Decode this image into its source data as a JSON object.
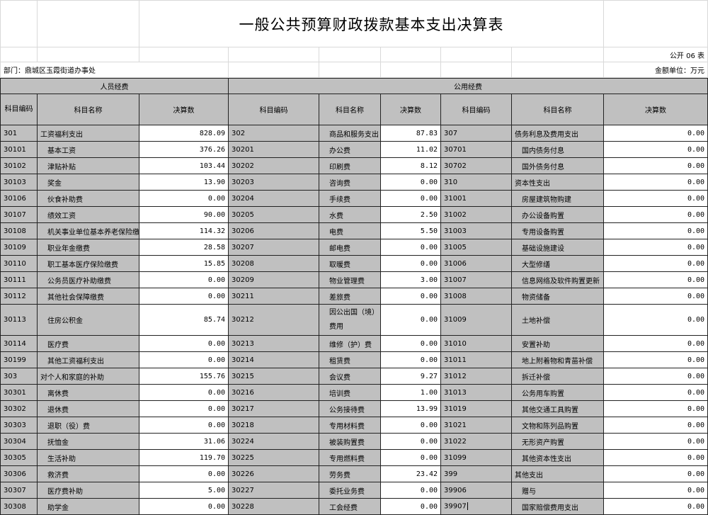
{
  "title": "一般公共预算财政拨款基本支出决算表",
  "table_no": "公开 06 表",
  "department": "部门：鼎城区玉霞街道办事处",
  "unit": "金额单位：万元",
  "group_headers": {
    "personnel": "人员经费",
    "public": "公用经费"
  },
  "col_headers": {
    "code": "科目编码",
    "name": "科目名称",
    "amount": "决算数",
    "code_wrapped": "科目编码"
  },
  "rows": [
    {
      "c1": "301",
      "n1": "工资福利支出",
      "a1": "828.09",
      "c2": "302",
      "n2": "商品和服务支出",
      "a2": "87.83",
      "c3": "307",
      "n3": "债务利息及费用支出",
      "a3": "0.00"
    },
    {
      "c1": "30101",
      "n1": "基本工资",
      "a1": "376.26",
      "c2": "30201",
      "n2": "办公费",
      "a2": "11.02",
      "c3": "30701",
      "n3": "国内债务付息",
      "a3": "0.00"
    },
    {
      "c1": "30102",
      "n1": "津贴补贴",
      "a1": "103.44",
      "c2": "30202",
      "n2": "印刷费",
      "a2": "8.12",
      "c3": "30702",
      "n3": "国外债务付息",
      "a3": "0.00"
    },
    {
      "c1": "30103",
      "n1": "奖金",
      "a1": "13.90",
      "c2": "30203",
      "n2": "咨询费",
      "a2": "0.00",
      "c3": "310",
      "n3": "资本性支出",
      "a3": "0.00"
    },
    {
      "c1": "30106",
      "n1": "伙食补助费",
      "a1": "0.00",
      "c2": "30204",
      "n2": "手续费",
      "a2": "0.00",
      "c3": "31001",
      "n3": "房屋建筑物购建",
      "a3": "0.00"
    },
    {
      "c1": "30107",
      "n1": "绩效工资",
      "a1": "90.00",
      "c2": "30205",
      "n2": "水费",
      "a2": "2.50",
      "c3": "31002",
      "n3": "办公设备购置",
      "a3": "0.00"
    },
    {
      "c1": "30108",
      "n1": "机关事业单位基本养老保险缴费",
      "a1": "114.32",
      "c2": "30206",
      "n2": "电费",
      "a2": "5.50",
      "c3": "31003",
      "n3": "专用设备购置",
      "a3": "0.00"
    },
    {
      "c1": "30109",
      "n1": "职业年金缴费",
      "a1": "28.58",
      "c2": "30207",
      "n2": "邮电费",
      "a2": "0.00",
      "c3": "31005",
      "n3": "基础设施建设",
      "a3": "0.00"
    },
    {
      "c1": "30110",
      "n1": "职工基本医疗保险缴费",
      "a1": "15.85",
      "c2": "30208",
      "n2": "取暖费",
      "a2": "0.00",
      "c3": "31006",
      "n3": "大型修缮",
      "a3": "0.00"
    },
    {
      "c1": "30111",
      "n1": "公务员医疗补助缴费",
      "a1": "0.00",
      "c2": "30209",
      "n2": "物业管理费",
      "a2": "3.00",
      "c3": "31007",
      "n3": "信息网络及软件购置更新",
      "a3": "0.00"
    },
    {
      "c1": "30112",
      "n1": "其他社会保障缴费",
      "a1": "0.00",
      "c2": "30211",
      "n2": "差旅费",
      "a2": "0.00",
      "c3": "31008",
      "n3": "物资储备",
      "a3": "0.00"
    },
    {
      "c1": "30113",
      "n1": "住房公积金",
      "a1": "85.74",
      "c2": "30212",
      "n2": "因公出国（境）费用",
      "a2": "0.00",
      "c3": "31009",
      "n3": "土地补偿",
      "a3": "0.00",
      "tall": true
    },
    {
      "c1": "30114",
      "n1": "医疗费",
      "a1": "0.00",
      "c2": "30213",
      "n2": "维修（护）费",
      "a2": "0.00",
      "c3": "31010",
      "n3": "安置补助",
      "a3": "0.00"
    },
    {
      "c1": "30199",
      "n1": "其他工资福利支出",
      "a1": "0.00",
      "c2": "30214",
      "n2": "租赁费",
      "a2": "0.00",
      "c3": "31011",
      "n3": "地上附着物和青苗补偿",
      "a3": "0.00"
    },
    {
      "c1": "303",
      "n1": "对个人和家庭的补助",
      "a1": "155.76",
      "c2": "30215",
      "n2": "会议费",
      "a2": "9.27",
      "c3": "31012",
      "n3": "拆迁补偿",
      "a3": "0.00"
    },
    {
      "c1": "30301",
      "n1": "离休费",
      "a1": "0.00",
      "c2": "30216",
      "n2": "培训费",
      "a2": "1.00",
      "c3": "31013",
      "n3": "公务用车购置",
      "a3": "0.00"
    },
    {
      "c1": "30302",
      "n1": "退休费",
      "a1": "0.00",
      "c2": "30217",
      "n2": "公务接待费",
      "a2": "13.99",
      "c3": "31019",
      "n3": "其他交通工具购置",
      "a3": "0.00"
    },
    {
      "c1": "30303",
      "n1": "退职（役）费",
      "a1": "0.00",
      "c2": "30218",
      "n2": "专用材料费",
      "a2": "0.00",
      "c3": "31021",
      "n3": "文物和陈列品购置",
      "a3": "0.00"
    },
    {
      "c1": "30304",
      "n1": "抚恤金",
      "a1": "31.06",
      "c2": "30224",
      "n2": "被装购置费",
      "a2": "0.00",
      "c3": "31022",
      "n3": "无形资产购置",
      "a3": "0.00"
    },
    {
      "c1": "30305",
      "n1": "生活补助",
      "a1": "119.70",
      "c2": "30225",
      "n2": "专用燃料费",
      "a2": "0.00",
      "c3": "31099",
      "n3": "其他资本性支出",
      "a3": "0.00"
    },
    {
      "c1": "30306",
      "n1": "救济费",
      "a1": "0.00",
      "c2": "30226",
      "n2": "劳务费",
      "a2": "23.42",
      "c3": "399",
      "n3": "其他支出",
      "a3": "0.00"
    },
    {
      "c1": "30307",
      "n1": "医疗费补助",
      "a1": "5.00",
      "c2": "30227",
      "n2": "委托业务费",
      "a2": "0.00",
      "c3": "39906",
      "n3": "赠与",
      "a3": "0.00"
    },
    {
      "c1": "30308",
      "n1": "助学金",
      "a1": "0.00",
      "c2": "30228",
      "n2": "工会经费",
      "a2": "0.00",
      "c3": "39907",
      "n3": "国家赔偿费用支出",
      "a3": "0.00"
    }
  ],
  "indent": {
    "n1": [
      false,
      true,
      true,
      true,
      true,
      true,
      true,
      true,
      true,
      true,
      true,
      true,
      true,
      true,
      false,
      true,
      true,
      true,
      true,
      true,
      true,
      true,
      true
    ],
    "n3": [
      false,
      true,
      true,
      false,
      true,
      true,
      true,
      true,
      true,
      true,
      true,
      true,
      true,
      true,
      true,
      true,
      true,
      true,
      true,
      true,
      false,
      true,
      true
    ]
  },
  "colors": {
    "header_fill": "#c0c0c0",
    "grid": "#222222",
    "light_grid": "#d9d9d9"
  }
}
